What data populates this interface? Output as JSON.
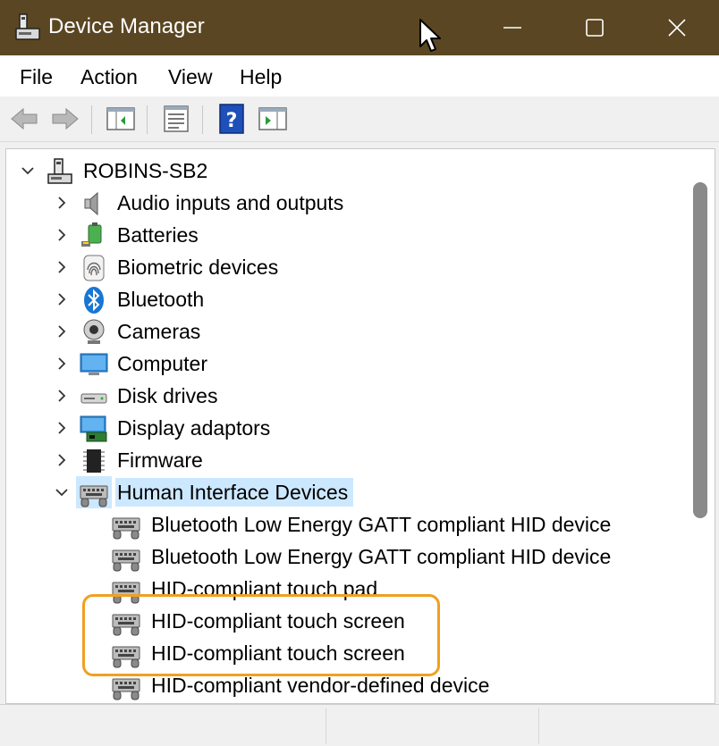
{
  "window": {
    "title": "Device Manager",
    "title_bar_color": "#5a4623",
    "controls": [
      "minimize",
      "maximize",
      "close"
    ]
  },
  "menu": [
    "File",
    "Action",
    "View",
    "Help"
  ],
  "toolbar": {
    "buttons": [
      "back-icon",
      "forward-icon",
      "show-hide-console-tree-icon",
      "properties-icon",
      "help-icon",
      "show-action-pane-icon"
    ]
  },
  "tree": {
    "root": {
      "label": "ROBINS-SB2",
      "icon": "computer-tower-icon",
      "expanded": true
    },
    "categories": [
      {
        "label": "Audio inputs and outputs",
        "icon": "speaker-icon"
      },
      {
        "label": "Batteries",
        "icon": "battery-icon"
      },
      {
        "label": "Biometric devices",
        "icon": "fingerprint-icon"
      },
      {
        "label": "Bluetooth",
        "icon": "bluetooth-icon"
      },
      {
        "label": "Cameras",
        "icon": "webcam-icon"
      },
      {
        "label": "Computer",
        "icon": "monitor-icon"
      },
      {
        "label": "Disk drives",
        "icon": "disk-drive-icon"
      },
      {
        "label": "Display adaptors",
        "icon": "display-adapter-icon"
      },
      {
        "label": "Firmware",
        "icon": "chip-icon"
      },
      {
        "label": "Human Interface Devices",
        "icon": "hid-icon",
        "expanded": true,
        "selected": true
      }
    ],
    "hid_children": [
      "Bluetooth Low Energy GATT compliant HID device",
      "Bluetooth Low Energy GATT compliant HID device",
      "HID-compliant touch pad",
      "HID-compliant touch screen",
      "HID-compliant touch screen",
      "HID-compliant vendor-defined device"
    ],
    "selection_color": "#cce8ff"
  },
  "annotation": {
    "highlight_color": "#f0a020"
  }
}
